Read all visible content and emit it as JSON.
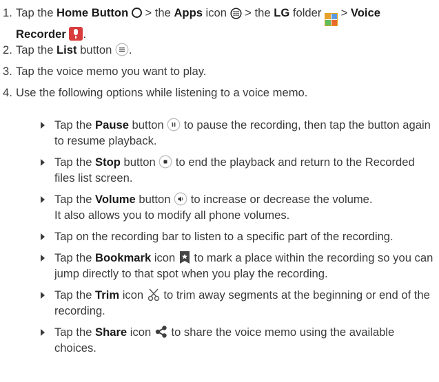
{
  "steps": [
    {
      "num": "1.",
      "t0": "Tap the ",
      "b0": "Home Button",
      "t1": " > the ",
      "b1": "Apps",
      "t2": " icon ",
      "t3": " > the ",
      "b2": "LG",
      "t4": " folder ",
      "t5": " > ",
      "b3": "Voice Recorder",
      "t6": "."
    },
    {
      "num": "2.",
      "t0": "Tap the ",
      "b0": "List",
      "t1": " button ",
      "t2": "."
    },
    {
      "num": "3.",
      "t0": "Tap the voice memo you want to play."
    },
    {
      "num": "4.",
      "t0": "Use the following options while listening to a voice memo."
    }
  ],
  "options": [
    {
      "t0": "Tap the ",
      "b0": "Pause",
      "t1": " button ",
      "t2": " to pause the recording, then tap the button again to resume playback."
    },
    {
      "t0": "Tap the ",
      "b0": "Stop",
      "t1": " button ",
      "t2": " to end the playback and return to the Recorded files list screen."
    },
    {
      "t0": "Tap the ",
      "b0": "Volume",
      "t1": " button ",
      "t2": " to increase or decrease the volume.",
      "t3": "It also allows you to modify all phone volumes."
    },
    {
      "t0": "Tap on the recording bar to listen to a specific part of the recording."
    },
    {
      "t0": "Tap the ",
      "b0": "Bookmark",
      "t1": " icon ",
      "t2": " to mark a place within the recording so you can jump directly to that spot when you play the recording."
    },
    {
      "t0": "Tap the ",
      "b0": "Trim",
      "t1": " icon ",
      "t2": " to trim away segments at the beginning or end of the recording."
    },
    {
      "t0": "Tap the ",
      "b0": "Share",
      "t1": " icon ",
      "t2": " to share the voice memo using the available choices."
    }
  ],
  "icons": {
    "home": "home-button-circle-icon",
    "apps": "apps-grid-icon",
    "lg": "lg-folder-icon",
    "recorder": "voice-recorder-icon",
    "list": "list-button-icon",
    "pause": "pause-button-icon",
    "stop": "stop-button-icon",
    "volume": "volume-button-icon",
    "bookmark": "bookmark-icon",
    "trim": "scissors-icon",
    "share": "share-icon"
  },
  "colors": {
    "text": "#3a3a3a",
    "recorder_red": "#d83c3c",
    "lg_orange": "#e8a12b"
  }
}
